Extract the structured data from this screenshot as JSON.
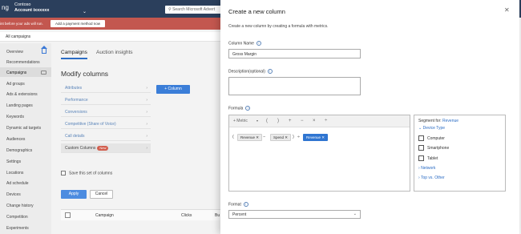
{
  "app": {
    "brand_partial": "ng",
    "company": "Contoso",
    "account": "Account ixxxxxx",
    "search_placeholder": "Search Microsoft Advert"
  },
  "alert": {
    "text": "int before your ads will run.",
    "button": "Add a payment method now"
  },
  "breadcrumb": "All campaigns",
  "sidebar": {
    "items": [
      "Overview",
      "Recommendations",
      "Campaigns",
      "Ad groups",
      "Ads & extensions",
      "Landing pages",
      "Keywords",
      "Dynamic ad targets",
      "Audiences",
      "Demographics",
      "Settings",
      "Locations",
      "Ad schedule",
      "Devices",
      "Change history",
      "Competition",
      "Experiments"
    ]
  },
  "main": {
    "tabs": [
      "Campaigns",
      "Auction insights"
    ],
    "title": "Modify columns",
    "categories": [
      "Attributes",
      "Performance",
      "Conversions",
      "Competitive (Share of Voice)",
      "Call details",
      "Custom Columns"
    ],
    "new_badge": "New",
    "column_button": "+ Column",
    "save_set": "Save this set of columns",
    "apply": "Apply",
    "cancel": "Cancel",
    "table_headers": [
      "Campaign",
      "Clicks",
      "Bu"
    ]
  },
  "panel": {
    "title": "Create a new column",
    "description": "Create a new column by creating a formula with metrics.",
    "column_name_label": "Column Name",
    "column_name_value": "Gross Margin",
    "description_label": "Description(optional)",
    "formula_label": "Formula",
    "toolbar": {
      "metric": "+ Metric",
      "ops": [
        "(",
        ")",
        "+",
        "−",
        "×",
        "÷"
      ]
    },
    "formula": {
      "open": "(",
      "t1": "Revenue",
      "minus": "−",
      "t2": "Spend",
      "close": ")",
      "div": "÷",
      "t3": "Revenue"
    },
    "segment": {
      "label": "Segment for:",
      "metric": "Revenue",
      "device_type": "Device Type",
      "options": [
        "Computer",
        "Smartphone",
        "Tablet"
      ],
      "network": "Network",
      "top_other": "Top vs. Other"
    },
    "format_label": "Format",
    "format_value": "Percent"
  }
}
